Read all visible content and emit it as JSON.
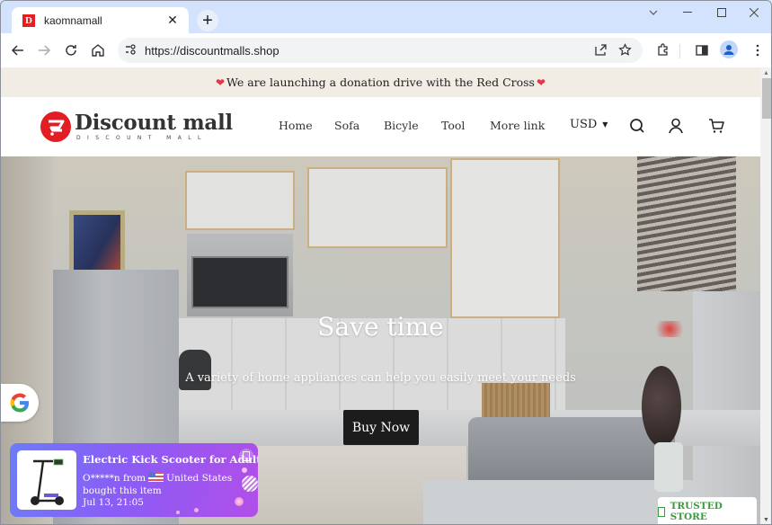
{
  "browser": {
    "tab": {
      "favicon_letter": "D",
      "title": "kaomnamall",
      "close_icon": "close-icon"
    },
    "new_tab_label": "+",
    "url": "https://discountmalls.shop",
    "window_controls": [
      "chevron-down-icon",
      "minimize-icon",
      "maximize-icon",
      "close-icon"
    ],
    "toolbar_icons": [
      "back-icon",
      "forward-icon",
      "reload-icon",
      "home-icon",
      "site-info-icon",
      "share-icon",
      "star-icon",
      "extensions-icon",
      "side-panel-icon",
      "profile-icon",
      "menu-icon"
    ]
  },
  "announcement": {
    "text": "We are launching a donation drive with the Red Cross",
    "heart": "❤"
  },
  "header": {
    "logo_main": "Discount mall",
    "logo_sub": "DISCOUNT MALL",
    "nav": [
      {
        "label": "Home"
      },
      {
        "label": "Sofa"
      },
      {
        "label": "Bicyle"
      },
      {
        "label": "Tool"
      },
      {
        "label": "More link"
      }
    ],
    "currency": "USD",
    "icons": [
      "search-icon",
      "account-icon",
      "cart-icon"
    ]
  },
  "hero": {
    "title": "Save time",
    "subtitle": "A variety of home appliances can help you easily meet your needs",
    "button": "Buy Now"
  },
  "popup": {
    "title": "Electric Kick Scooter for Adults ...",
    "buyer": "O*****n from",
    "country": "United States bought this item",
    "time": "Jul 13, 21:05"
  },
  "trusted_badge": "TRUSTED STORE",
  "colors": {
    "accent_red": "#e21d23",
    "announcement_bg": "#f1ede4",
    "button_dark": "#1c1c1c",
    "trusted_green": "#3a9b3a",
    "popup_gradient_start": "#6d7cf6",
    "popup_gradient_end": "#b04fe8"
  }
}
